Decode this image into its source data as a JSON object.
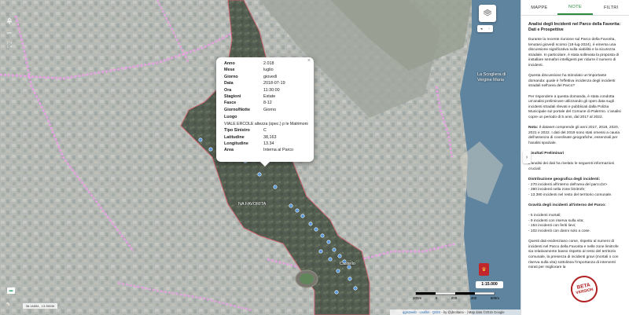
{
  "map": {
    "zoom_in": "+",
    "zoom_out": "−",
    "place_labels": {
      "favorita": "NA FAVORITA",
      "vergine_line1": "La Scogliera di",
      "vergine_line2": "Vergine Maria",
      "castello": "Castello"
    },
    "coords_readout": "38.14894 , 13.35036",
    "scale_ratio": "1:15.000",
    "scalebar_ticks": [
      "200m",
      "0",
      "200",
      "400",
      "600m"
    ],
    "attribution": {
      "qgis2web": "qgis2web",
      "leaflet": "Leaflet",
      "qgis": "QGIS",
      "rest": " - by @jbroltano - | Map data ©2015 Google"
    },
    "beta_line1": "BETA",
    "beta_line2": "VERSION"
  },
  "popup": {
    "rows": [
      {
        "k": "Anno",
        "v": "2.018"
      },
      {
        "k": "Mese",
        "v": "luglio"
      },
      {
        "k": "Giorno",
        "v": "giovedì"
      },
      {
        "k": "Data",
        "v": "2018-07-19"
      },
      {
        "k": "Ora",
        "v": "11:30:00"
      },
      {
        "k": "Stagioni",
        "v": "Estate"
      },
      {
        "k": "Fasce",
        "v": "8-12"
      },
      {
        "k": "Giorno/Notte",
        "v": "Giorno"
      }
    ],
    "luogo_label": "Luogo",
    "luogo_value": "VIALE ERCOLE altezza (spec.) p le Matrimoni",
    "rows2": [
      {
        "k": "Tipo Sinistro",
        "v": "C"
      },
      {
        "k": "Latitudine",
        "v": "38,163"
      },
      {
        "k": "Longitudine",
        "v": "13.34"
      },
      {
        "k": "Area",
        "v": "Interna al Parco"
      }
    ]
  },
  "panel": {
    "tabs": [
      "MAPPE",
      "NOTE",
      "FILTRI"
    ],
    "active_tab": "NOTE",
    "title": "Analisi degli Incidenti nel Parco della Favorita: Dati e Prospettive",
    "p1": "Durante la recente riunione sul Parco della Favorita, tenutasi giovedì scorso (18-lug-2024), è emersa una discussione significativa sulla viabilità e la sicurezza stradale. In particolare, è stata sollevata la proposta di installare semafori intelligenti per ridurre il numero di incidenti.",
    "p2": "Questa discussione ha stimolato un'importante domanda: quale è l'effettiva incidenza degli incidenti stradali nell'area del Parco?",
    "p3": "Per rispondere a questa domanda, è stata condotta un'analisi preliminare utilizzando gli open data sugli incidenti stradali rilevati e pubblicati dalla Polizia Municipale sul portale del Comune di Palermo. L'analisi copre un periodo di 5 anni, dal 2017 al 2022.",
    "note_label": "Nota:",
    "note_text": " Il dataset comprende gli anni 2017, 2018, 2020, 2021 e 2022. I dati del 2019 sono stati omessi a causa dell'assenza di coordinate geografiche, essenziali per l'analisi spaziale.",
    "h_results": "Risultati Preliminari",
    "p4": "L'analisi dei dati ha rivelato le seguenti informazioni cruciali:",
    "h_distrib": "Distribuzione geografica degli incidenti:",
    "d1": "- 270 incidenti all'interno dell'area del parco;br>",
    "d2": "- 390 incidenti nella zone limitrofe;",
    "d3": "- 13.390 incidenti nel resto del territorio comunale.",
    "h_grav": "Gravità degli incidenti all'interno del Parco:",
    "g1": "- 5 incidenti mortali;",
    "g2": "- 9 incidenti con riserva sulla vita;",
    "g3": "- 154 incidenti con feriti lievi;",
    "g4": "- 102 incidenti con danni solo a cose.",
    "p5": "Questi dati evidenziano come, rispetto al numero di incidenti nel Parco della Favorita e nelle zone limitrofe sia relativamente basso rispetto al resto del territorio comunale, la presenza di incidenti gravi (mortali o con riserva sulla vita) sottolinea l'importanza di interventi mirati per migliorare la"
  }
}
